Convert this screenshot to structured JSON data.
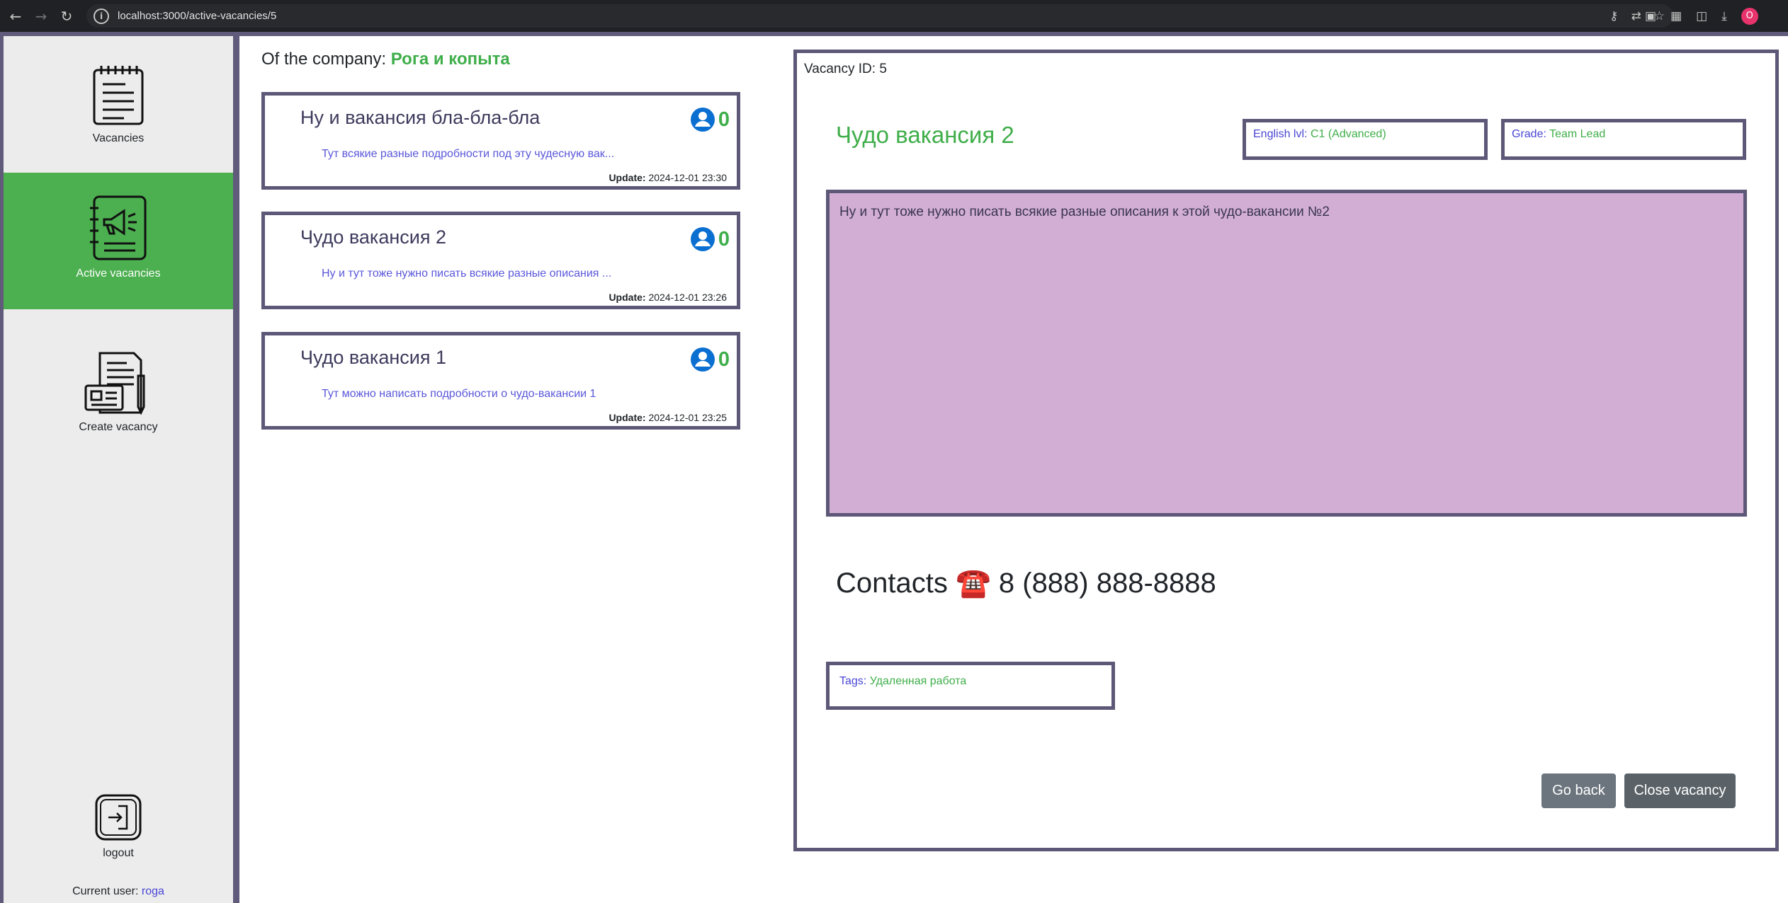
{
  "browser": {
    "url": "localhost:3000/active-vacancies/5",
    "profile_initial": "O"
  },
  "sidebar": {
    "items": [
      {
        "label": "Vacancies",
        "icon": "notepad-icon",
        "active": false
      },
      {
        "label": "Active vacancies",
        "icon": "megaphone-notebook-icon",
        "active": true
      },
      {
        "label": "Create vacancy",
        "icon": "document-pen-icon",
        "active": false
      },
      {
        "label": "logout",
        "icon": "logout-door-icon",
        "active": false
      }
    ],
    "current_user_label": "Current user:",
    "current_user": "roga"
  },
  "list": {
    "company_label": "Of the company:",
    "company_name": "Рога и копыта",
    "cards": [
      {
        "title": "Ну и вакансия бла-бла-бла",
        "count": "0",
        "description": "Тут всякие разные подробности под эту чудесную вак...",
        "update_label": "Update:",
        "update": "2024-12-01 23:30"
      },
      {
        "title": "Чудо вакансия 2",
        "count": "0",
        "description": "Ну и тут тоже нужно писать всякие разные описания ...",
        "update_label": "Update:",
        "update": "2024-12-01 23:26"
      },
      {
        "title": "Чудо вакансия 1",
        "count": "0",
        "description": "Тут можно написать подробности о чудо-вакансии 1",
        "update_label": "Update:",
        "update": "2024-12-01 23:25"
      }
    ]
  },
  "detail": {
    "vacancy_id_label": "Vacancy ID:",
    "vacancy_id": "5",
    "title": "Чудо вакансия 2",
    "english_label": "English lvl:",
    "english_value": "C1 (Advanced)",
    "grade_label": "Grade:",
    "grade_value": "Team Lead",
    "description": "Ну и тут тоже нужно писать всякие разные описания к этой чудо-вакансии №2",
    "contacts": "Contacts ☎️ 8 (888) 888-8888",
    "tags_label": "Tags:",
    "tags_value": "Удаленная работа",
    "go_back_label": "Go back",
    "close_label": "Close vacancy"
  },
  "colors": {
    "accent_green": "#3fae4a",
    "active_nav": "#4caf50",
    "frame": "#5d5877",
    "description_bg": "#d2aed5",
    "link_blue": "#4a47d4"
  }
}
